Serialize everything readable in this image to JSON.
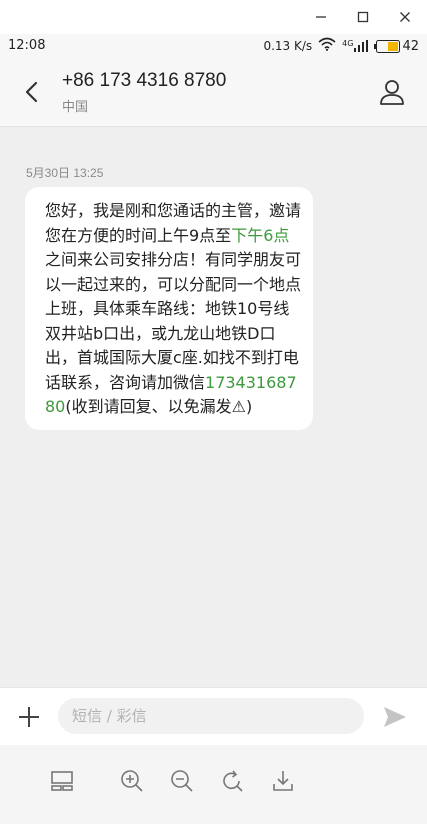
{
  "window": {
    "minimize_icon": "minimize-icon",
    "maximize_icon": "maximize-icon",
    "close_icon": "close-icon"
  },
  "status_bar": {
    "time": "12:08",
    "network_speed": "0.13 K/s",
    "signal": "4G",
    "battery": "42"
  },
  "header": {
    "phone": "+86 173 4316 8780",
    "region": "中国"
  },
  "conversation": {
    "date": "5月30日 13:25",
    "message": {
      "part1": "您好，我是刚和您通话的主管，邀请您在方便的时间上午9点至",
      "link1": "下午6点",
      "part2": "之间来公司安排分店！有同学朋友可以一起过来的，可以分配同一个地点上班，具体乘车路线：地铁10号线双井站b口出，或九龙山地铁D口出，首城国际大厦c座.如找不到打电话联系，咨询请加微信",
      "link2": "17343168780",
      "part3": "(收到请回复、以免漏发⚠)"
    }
  },
  "composer": {
    "placeholder": "短信 / 彩信"
  },
  "accent_color": "#3d9a3d"
}
